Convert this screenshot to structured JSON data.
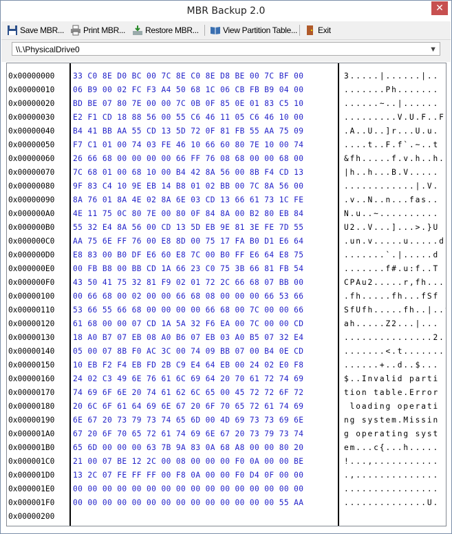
{
  "window": {
    "title": "MBR Backup 2.0",
    "close_glyph": "✕"
  },
  "toolbar": {
    "buttons": [
      {
        "label": "Save MBR...",
        "icon": "floppy-disk-icon"
      },
      {
        "label": "Print MBR...",
        "icon": "printer-icon"
      },
      {
        "label": "Restore MBR...",
        "icon": "restore-icon"
      },
      {
        "label": "View Partition Table...",
        "icon": "book-icon"
      },
      {
        "label": "Exit",
        "icon": "exit-door-icon"
      }
    ]
  },
  "drive": {
    "selected": "\\\\.\\PhysicalDrive0"
  },
  "hex": {
    "offsets": [
      "0x00000000",
      "0x00000010",
      "0x00000020",
      "0x00000030",
      "0x00000040",
      "0x00000050",
      "0x00000060",
      "0x00000070",
      "0x00000080",
      "0x00000090",
      "0x000000A0",
      "0x000000B0",
      "0x000000C0",
      "0x000000D0",
      "0x000000E0",
      "0x000000F0",
      "0x00000100",
      "0x00000110",
      "0x00000120",
      "0x00000130",
      "0x00000140",
      "0x00000150",
      "0x00000160",
      "0x00000170",
      "0x00000180",
      "0x00000190",
      "0x000001A0",
      "0x000001B0",
      "0x000001C0",
      "0x000001D0",
      "0x000001E0",
      "0x000001F0",
      "0x00000200"
    ],
    "bytes": [
      "33 C0 8E D0 BC 00 7C 8E C0 8E D8 BE 00 7C BF 00",
      "06 B9 00 02 FC F3 A4 50 68 1C 06 CB FB B9 04 00",
      "BD BE 07 80 7E 00 00 7C 0B 0F 85 0E 01 83 C5 10",
      "E2 F1 CD 18 88 56 00 55 C6 46 11 05 C6 46 10 00",
      "B4 41 BB AA 55 CD 13 5D 72 0F 81 FB 55 AA 75 09",
      "F7 C1 01 00 74 03 FE 46 10 66 60 80 7E 10 00 74",
      "26 66 68 00 00 00 00 66 FF 76 08 68 00 00 68 00",
      "7C 68 01 00 68 10 00 B4 42 8A 56 00 8B F4 CD 13",
      "9F 83 C4 10 9E EB 14 B8 01 02 BB 00 7C 8A 56 00",
      "8A 76 01 8A 4E 02 8A 6E 03 CD 13 66 61 73 1C FE",
      "4E 11 75 0C 80 7E 00 80 0F 84 8A 00 B2 80 EB 84",
      "55 32 E4 8A 56 00 CD 13 5D EB 9E 81 3E FE 7D 55",
      "AA 75 6E FF 76 00 E8 8D 00 75 17 FA B0 D1 E6 64",
      "E8 83 00 B0 DF E6 60 E8 7C 00 B0 FF E6 64 E8 75",
      "00 FB B8 00 BB CD 1A 66 23 C0 75 3B 66 81 FB 54",
      "43 50 41 75 32 81 F9 02 01 72 2C 66 68 07 BB 00",
      "00 66 68 00 02 00 00 66 68 08 00 00 00 66 53 66",
      "53 66 55 66 68 00 00 00 00 66 68 00 7C 00 00 66",
      "61 68 00 00 07 CD 1A 5A 32 F6 EA 00 7C 00 00 CD",
      "18 A0 B7 07 EB 08 A0 B6 07 EB 03 A0 B5 07 32 E4",
      "05 00 07 8B F0 AC 3C 00 74 09 BB 07 00 B4 0E CD",
      "10 EB F2 F4 EB FD 2B C9 E4 64 EB 00 24 02 E0 F8",
      "24 02 C3 49 6E 76 61 6C 69 64 20 70 61 72 74 69",
      "74 69 6F 6E 20 74 61 62 6C 65 00 45 72 72 6F 72",
      "20 6C 6F 61 64 69 6E 67 20 6F 70 65 72 61 74 69",
      "6E 67 20 73 79 73 74 65 6D 00 4D 69 73 73 69 6E",
      "67 20 6F 70 65 72 61 74 69 6E 67 20 73 79 73 74",
      "65 6D 00 00 00 63 7B 9A 83 0A 68 A8 00 00 80 20",
      "21 00 07 BE 12 2C 00 08 00 00 00 F0 0A 00 00 BE",
      "13 2C 07 FE FF FF 00 F8 0A 00 00 F0 D4 0F 00 00",
      "00 00 00 00 00 00 00 00 00 00 00 00 00 00 00 00",
      "00 00 00 00 00 00 00 00 00 00 00 00 00 00 55 AA",
      ""
    ],
    "ascii": [
      "3.....|......|..",
      ".......Ph.......",
      "......~..|......",
      ".........V.U.F..F..",
      ".A..U..]r...U.u.",
      "....t..F.f`.~..t",
      "&fh.....f.v.h..h.",
      "|h..h...B.V.....",
      "............|.V.",
      ".v..N..n...fas..",
      "N.u..~..........",
      "U2..V...]...>.}U",
      ".un.v.....u.....d",
      ".......`.|.....d",
      ".......f#.u:f..T",
      "CPAu2.....r,fh...",
      ".fh.....fh...fSf",
      "SfUfh.....fh..|..f",
      "ah.....Z2...|...",
      "...............2.",
      ".......<.t.......",
      "......+..d..$...",
      "$..Invalid parti",
      "tion table.Error",
      " loading operati",
      "ng system.Missin",
      "g operating syst",
      "em...c{...h.....",
      "!...,...........",
      ".,..............",
      "................",
      "..............U.",
      ""
    ]
  }
}
